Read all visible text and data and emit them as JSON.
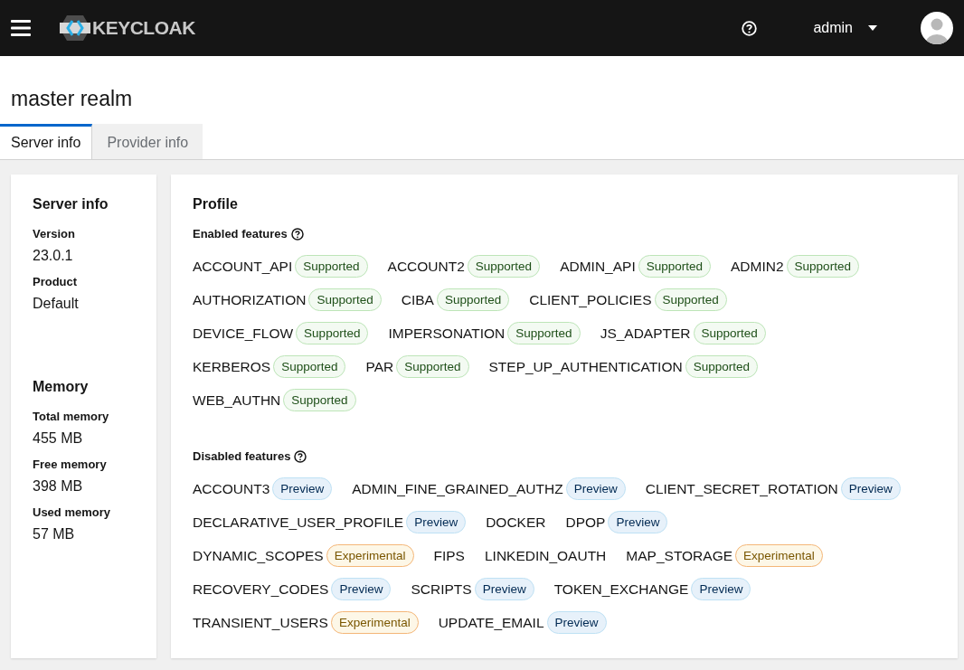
{
  "header": {
    "brand": "KEYCLOAK",
    "user": "admin"
  },
  "page_title": "master realm",
  "tabs": [
    {
      "label": "Server info",
      "selected": true
    },
    {
      "label": "Provider info",
      "selected": false
    }
  ],
  "server_info": {
    "title": "Server info",
    "fields": [
      {
        "label": "Version",
        "value": "23.0.1"
      },
      {
        "label": "Product",
        "value": "Default"
      }
    ]
  },
  "memory": {
    "title": "Memory",
    "fields": [
      {
        "label": "Total memory",
        "value": "455 MB"
      },
      {
        "label": "Free memory",
        "value": "398 MB"
      },
      {
        "label": "Used memory",
        "value": "57 MB"
      }
    ]
  },
  "profile": {
    "title": "Profile",
    "sections": [
      {
        "title": "Enabled features",
        "rows": [
          [
            {
              "name": "ACCOUNT_API",
              "badge": "Supported",
              "kind": "supported"
            },
            {
              "name": "ACCOUNT2",
              "badge": "Supported",
              "kind": "supported"
            },
            {
              "name": "ADMIN_API",
              "badge": "Supported",
              "kind": "supported"
            },
            {
              "name": "ADMIN2",
              "badge": "Supported",
              "kind": "supported"
            }
          ],
          [
            {
              "name": "AUTHORIZATION",
              "badge": "Supported",
              "kind": "supported"
            },
            {
              "name": "CIBA",
              "badge": "Supported",
              "kind": "supported"
            },
            {
              "name": "CLIENT_POLICIES",
              "badge": "Supported",
              "kind": "supported"
            }
          ],
          [
            {
              "name": "DEVICE_FLOW",
              "badge": "Supported",
              "kind": "supported"
            },
            {
              "name": "IMPERSONATION",
              "badge": "Supported",
              "kind": "supported"
            },
            {
              "name": "JS_ADAPTER",
              "badge": "Supported",
              "kind": "supported"
            }
          ],
          [
            {
              "name": "KERBEROS",
              "badge": "Supported",
              "kind": "supported"
            },
            {
              "name": "PAR",
              "badge": "Supported",
              "kind": "supported"
            },
            {
              "name": "STEP_UP_AUTHENTICATION",
              "badge": "Supported",
              "kind": "supported"
            }
          ],
          [
            {
              "name": "WEB_AUTHN",
              "badge": "Supported",
              "kind": "supported"
            }
          ]
        ]
      },
      {
        "title": "Disabled features",
        "rows": [
          [
            {
              "name": "ACCOUNT3",
              "badge": "Preview",
              "kind": "preview"
            },
            {
              "name": "ADMIN_FINE_GRAINED_AUTHZ",
              "badge": "Preview",
              "kind": "preview"
            },
            {
              "name": "CLIENT_SECRET_ROTATION",
              "badge": "Preview",
              "kind": "preview"
            }
          ],
          [
            {
              "name": "DECLARATIVE_USER_PROFILE",
              "badge": "Preview",
              "kind": "preview"
            },
            {
              "name": "DOCKER"
            },
            {
              "name": "DPOP",
              "badge": "Preview",
              "kind": "preview"
            }
          ],
          [
            {
              "name": "DYNAMIC_SCOPES",
              "badge": "Experimental",
              "kind": "experimental"
            },
            {
              "name": "FIPS"
            },
            {
              "name": "LINKEDIN_OAUTH"
            },
            {
              "name": "MAP_STORAGE",
              "badge": "Experimental",
              "kind": "experimental"
            }
          ],
          [
            {
              "name": "RECOVERY_CODES",
              "badge": "Preview",
              "kind": "preview"
            },
            {
              "name": "SCRIPTS",
              "badge": "Preview",
              "kind": "preview"
            },
            {
              "name": "TOKEN_EXCHANGE",
              "badge": "Preview",
              "kind": "preview"
            }
          ],
          [
            {
              "name": "TRANSIENT_USERS",
              "badge": "Experimental",
              "kind": "experimental"
            },
            {
              "name": "UPDATE_EMAIL",
              "badge": "Preview",
              "kind": "preview"
            }
          ]
        ]
      }
    ]
  }
}
